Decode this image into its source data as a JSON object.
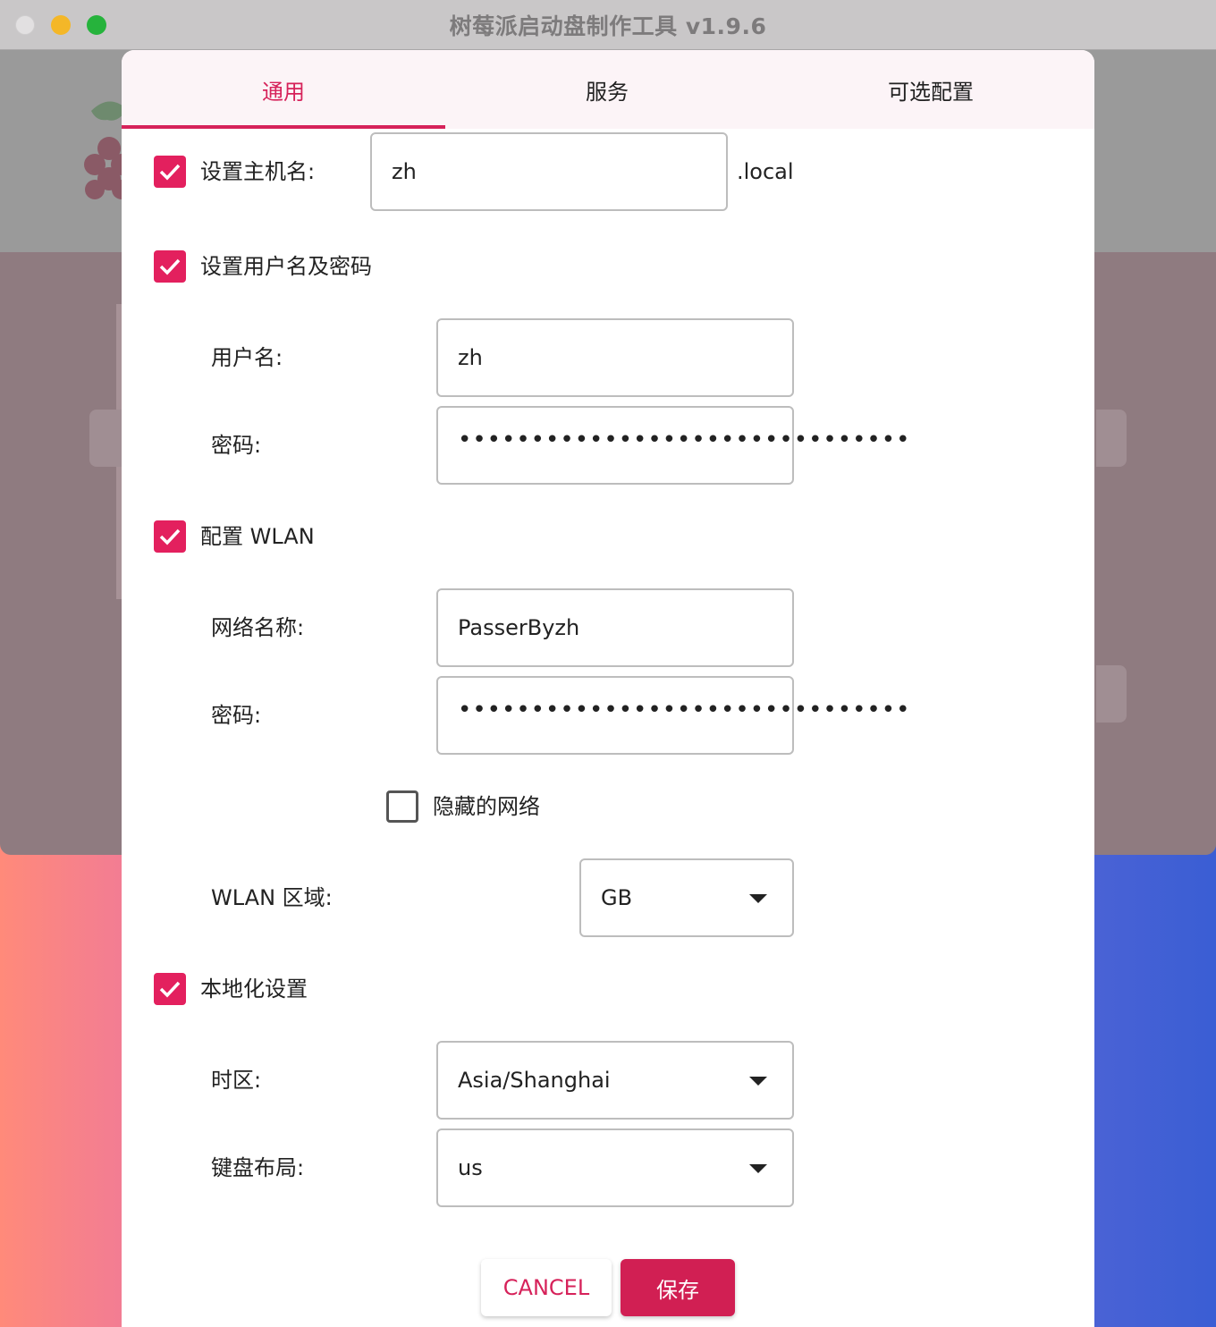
{
  "window": {
    "title": "树莓派启动盘制作工具 v1.9.6"
  },
  "tabs": [
    {
      "label": "通用",
      "active": true
    },
    {
      "label": "服务",
      "active": false
    },
    {
      "label": "可选配置",
      "active": false
    }
  ],
  "hostname": {
    "checked": true,
    "label": "设置主机名:",
    "value": "zh",
    "suffix": ".local"
  },
  "user": {
    "checked": true,
    "label": "设置用户名及密码",
    "username_label": "用户名:",
    "username_value": "zh",
    "password_label": "密码:",
    "password_mask": "•••••••••••••••••••••••••••••••"
  },
  "wlan": {
    "checked": true,
    "label": "配置 WLAN",
    "ssid_label": "网络名称:",
    "ssid_value": "PasserByzh",
    "password_label": "密码:",
    "password_mask": "•••••••••••••••••••••••••••••••",
    "hidden_checked": false,
    "hidden_label": "隐藏的网络",
    "country_label": "WLAN 区域:",
    "country_value": "GB"
  },
  "locale": {
    "checked": true,
    "label": "本地化设置",
    "timezone_label": "时区:",
    "timezone_value": "Asia/Shanghai",
    "keyboard_label": "键盘布局:",
    "keyboard_value": "us"
  },
  "buttons": {
    "cancel": "CANCEL",
    "save": "保存"
  },
  "colors": {
    "accent": "#d6225a",
    "checkbox": "#e3205e",
    "save_button": "#d11f53"
  },
  "icons": [
    "check-icon",
    "dropdown-caret-icon",
    "raspberry-pi-logo"
  ]
}
